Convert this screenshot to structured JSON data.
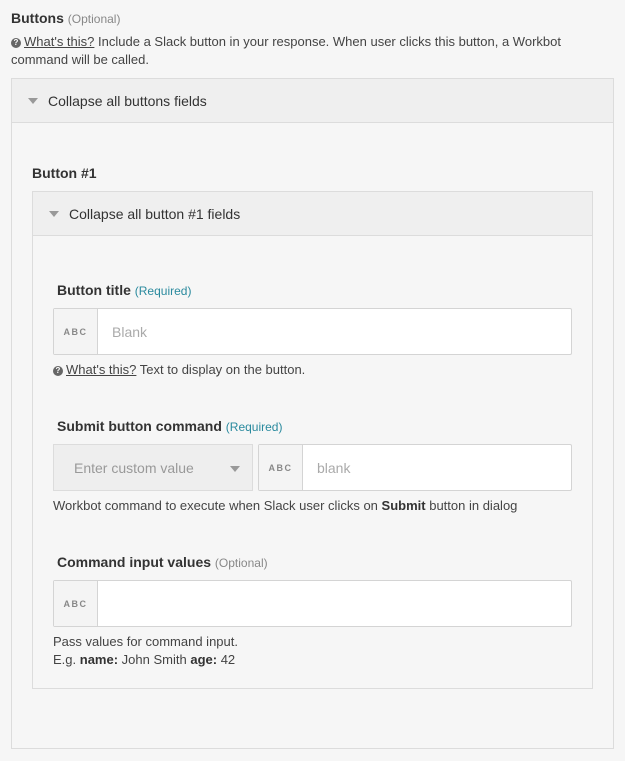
{
  "section": {
    "title": "Buttons",
    "optional_tag": "(Optional)",
    "help_link": "What's this?",
    "help_text": "Include a Slack button in your response. When user clicks this button, a Workbot command will be called.",
    "collapse_label": "Collapse all buttons fields"
  },
  "button1": {
    "title": "Button #1",
    "collapse_label": "Collapse all button #1 fields",
    "button_title": {
      "label": "Button title",
      "required_tag": "(Required)",
      "type_badge": "ABC",
      "placeholder": "Blank",
      "help_link": "What's this?",
      "help_text": "Text to display on the button."
    },
    "submit_command": {
      "label": "Submit button command",
      "required_tag": "(Required)",
      "select_value": "Enter custom value",
      "type_badge": "ABC",
      "placeholder": "blank",
      "help_prefix": "Workbot command to execute when Slack user clicks on",
      "help_bold": "Submit",
      "help_suffix": "button in dialog"
    },
    "command_inputs": {
      "label": "Command input values",
      "optional_tag": "(Optional)",
      "type_badge": "ABC",
      "value": "",
      "help_line1": "Pass values for command input.",
      "example_prefix": "E.g.",
      "example_key1": "name:",
      "example_val1": "John Smith",
      "example_key2": "age:",
      "example_val2": "42"
    }
  },
  "colors": {
    "required": "#2a8a9e",
    "background": "#f6f6f6",
    "bar": "#efefef"
  }
}
